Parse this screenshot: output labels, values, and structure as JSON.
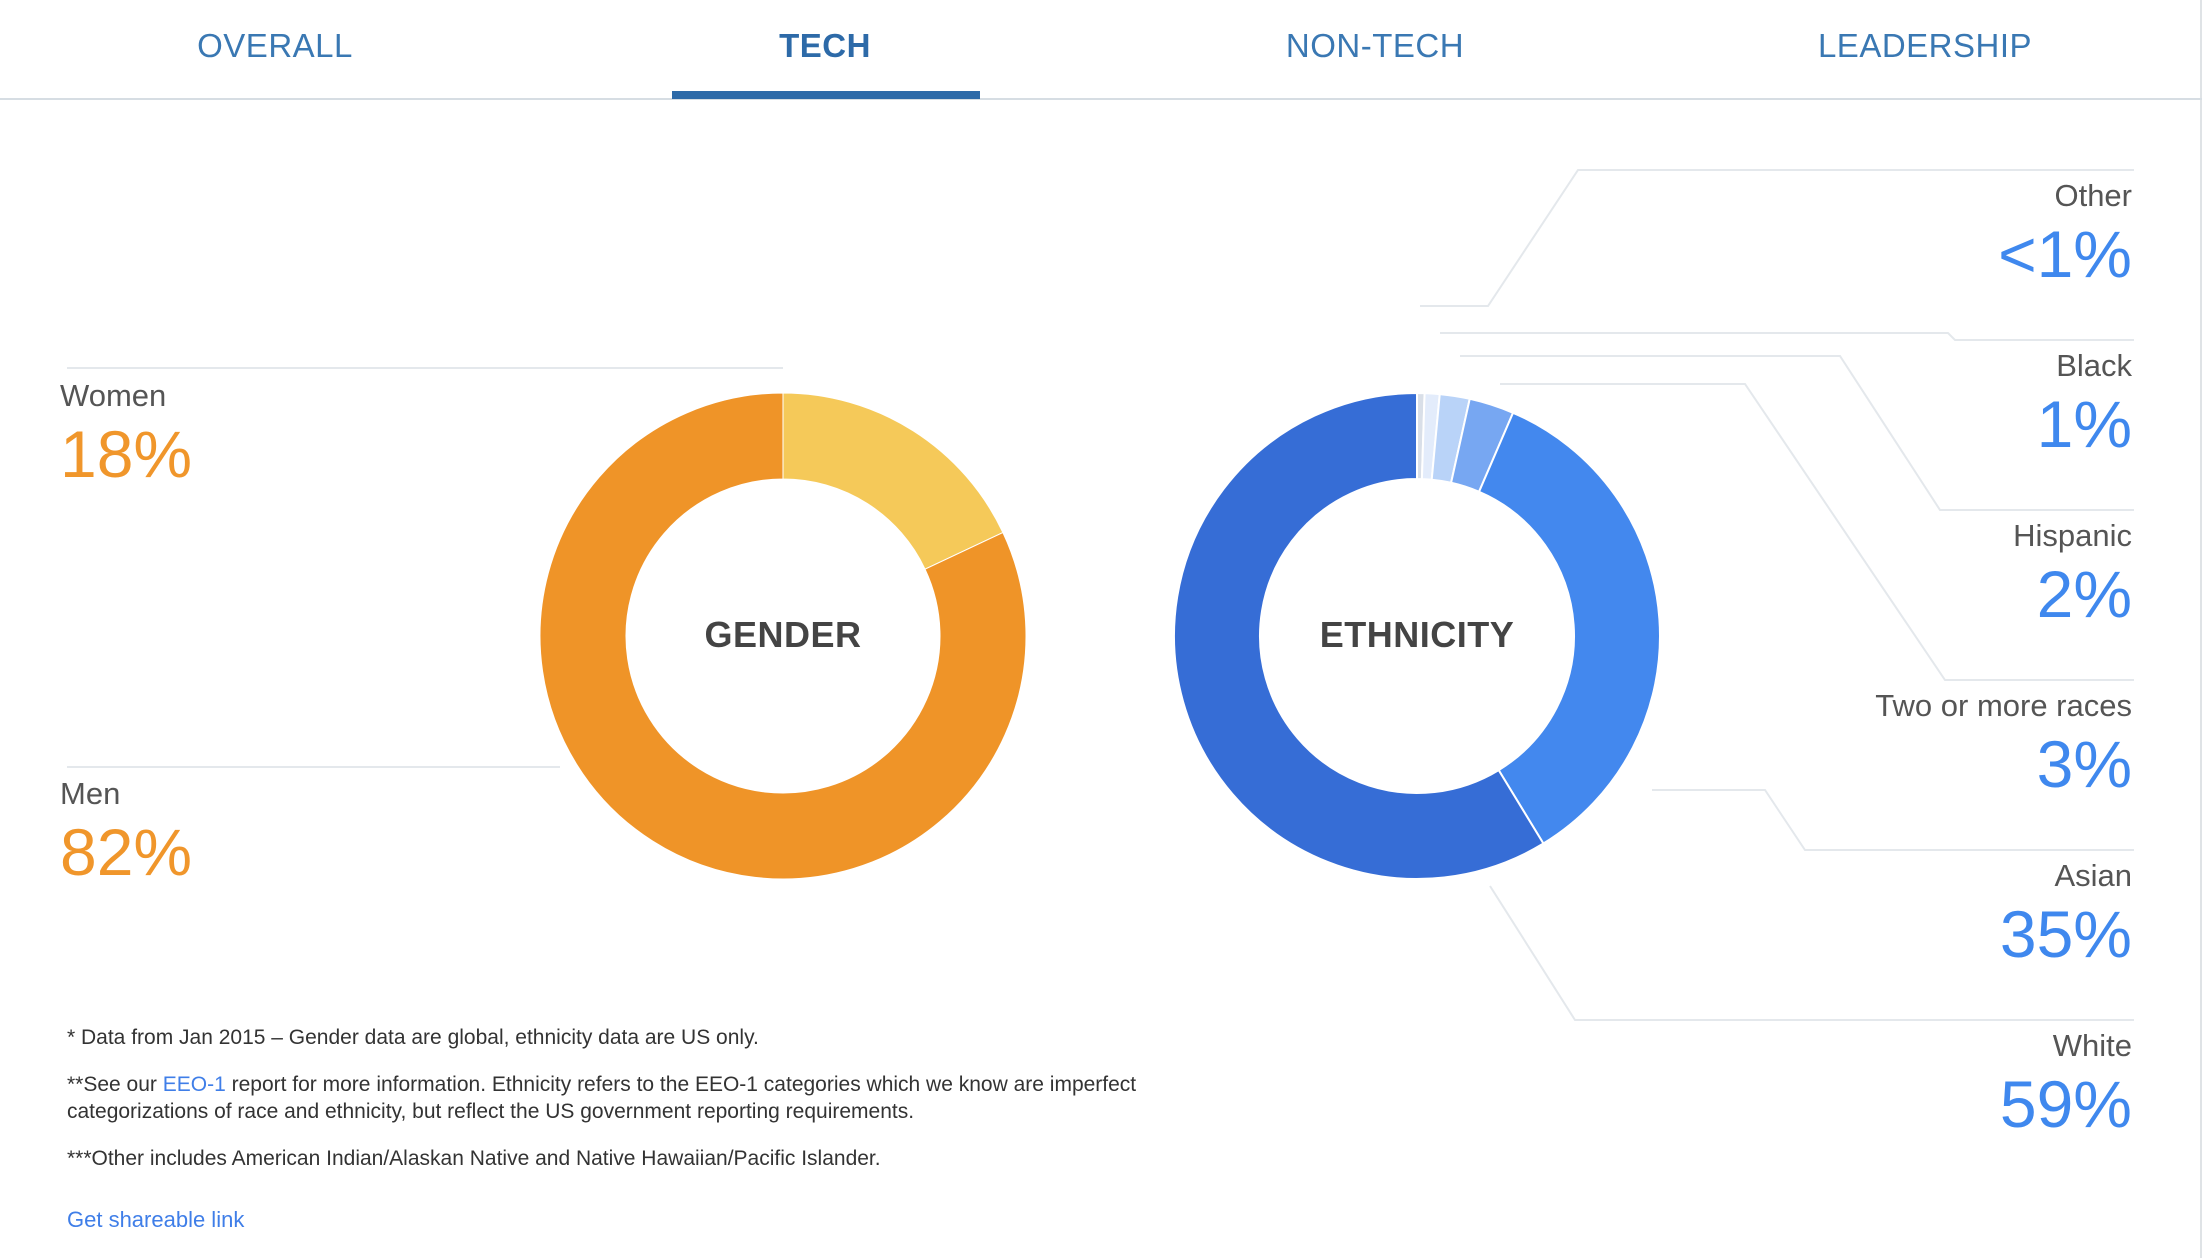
{
  "tabs": [
    {
      "label": "OVERALL",
      "active": false
    },
    {
      "label": "TECH",
      "active": true
    },
    {
      "label": "NON-TECH",
      "active": false
    },
    {
      "label": "LEADERSHIP",
      "active": false
    }
  ],
  "colors": {
    "accent": "#2d6aa8",
    "women": "#f5c959",
    "men": "#ef9428",
    "white": "#366dd6",
    "asian": "#4388ee",
    "two_or_more": "#77a7f2",
    "hispanic": "#b9d3f8",
    "black": "#e3ecfb",
    "other": "#d9dfe8"
  },
  "chart_data": [
    {
      "type": "pie",
      "title": "GENDER",
      "categories": [
        "Women",
        "Men"
      ],
      "values": [
        18,
        82
      ],
      "labels": [
        "18%",
        "82%"
      ]
    },
    {
      "type": "pie",
      "title": "ETHNICITY",
      "categories": [
        "Other",
        "Black",
        "Hispanic",
        "Two or more races",
        "Asian",
        "White"
      ],
      "values": [
        0.5,
        1,
        2,
        3,
        35,
        59
      ],
      "labels": [
        "<1%",
        "1%",
        "2%",
        "3%",
        "35%",
        "59%"
      ]
    }
  ],
  "notes": {
    "note1": "* Data from Jan 2015 – Gender data are global, ethnicity data are US only.",
    "note2_before": "**See our ",
    "note2_link": "EEO-1",
    "note2_after": " report for more information. Ethnicity refers to the EEO-1 categories which we know are imperfect categorizations of race and ethnicity, but reflect the US government reporting requirements.",
    "note3": "***Other includes American Indian/Alaskan Native and Native Hawaiian/Pacific Islander.",
    "share_link": "Get shareable link"
  }
}
